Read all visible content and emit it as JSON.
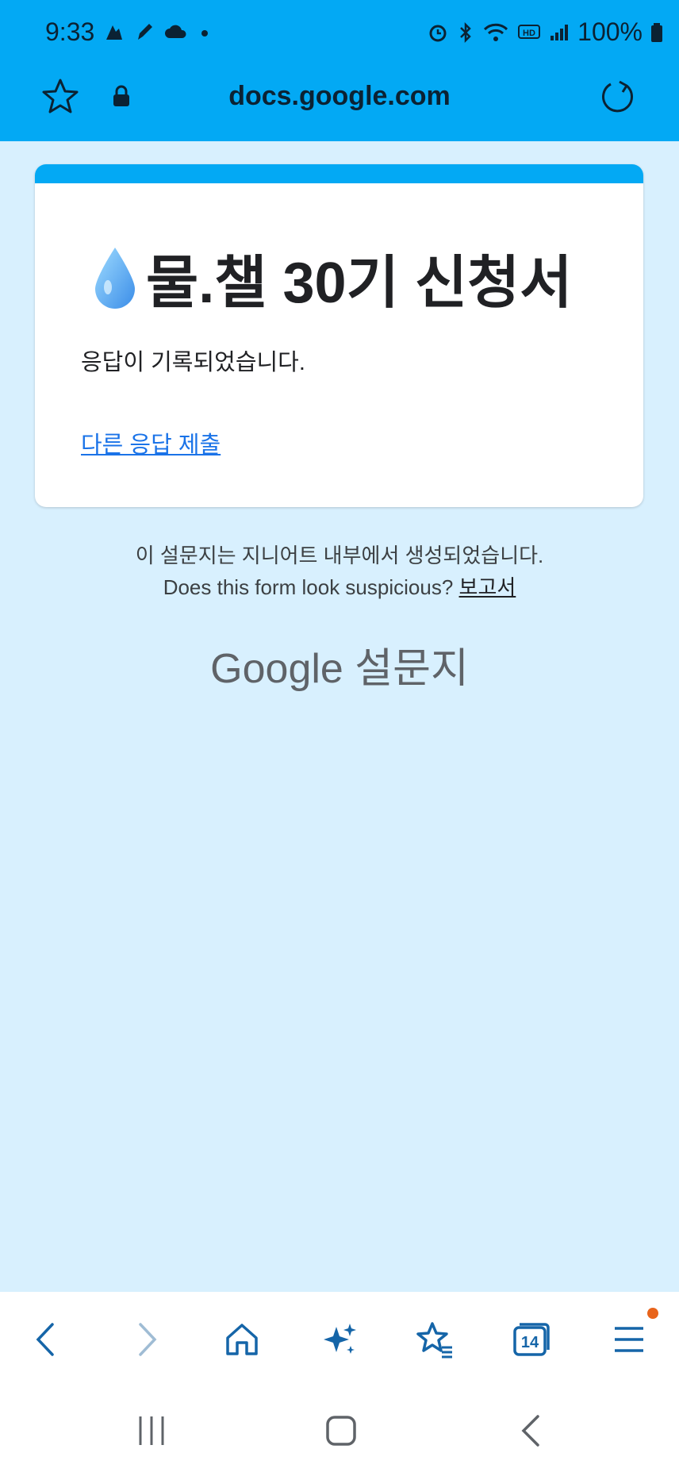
{
  "status_bar": {
    "time": "9:33",
    "battery": "100%"
  },
  "browser": {
    "url": "docs.google.com",
    "accent_color": "#03a9f4"
  },
  "form": {
    "title": "물.챌 30기 신청서",
    "title_emoji": "💧",
    "confirmation": "응답이 기록되었습니다.",
    "submit_another": "다른 응답 제출"
  },
  "footer": {
    "created_in": "이 설문지는 지니어트 내부에서 생성되었습니다.",
    "suspicious": "Does this form look suspicious?",
    "report": "보고서",
    "brand_google": "Google",
    "brand_forms": "설문지"
  },
  "bottom_nav": {
    "tab_count": "14",
    "icons": [
      "back-icon",
      "forward-icon",
      "home-icon",
      "sparkle-icon",
      "bookmark-star-icon",
      "tabs-icon",
      "menu-icon"
    ]
  }
}
